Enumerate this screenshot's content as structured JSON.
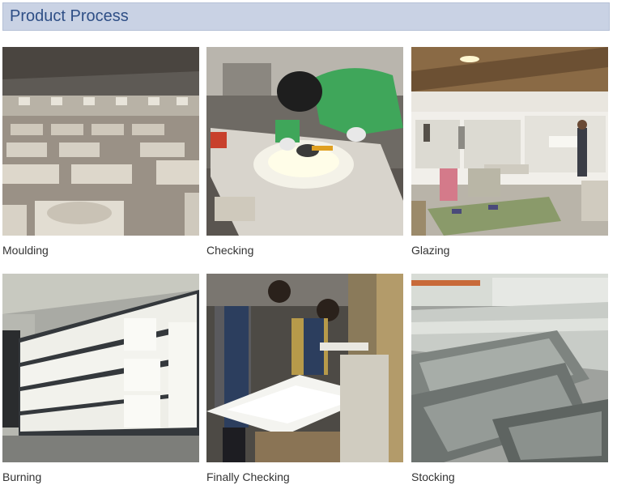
{
  "header": {
    "title": "Product Process"
  },
  "steps": [
    {
      "label": "Moulding"
    },
    {
      "label": "Checking"
    },
    {
      "label": "Glazing"
    },
    {
      "label": "Burning"
    },
    {
      "label": "Finally Checking"
    },
    {
      "label": "Stocking"
    }
  ],
  "colors": {
    "banner_bg": "#c9d2e4",
    "banner_text": "#2f4f86",
    "caption_text": "#333333"
  }
}
